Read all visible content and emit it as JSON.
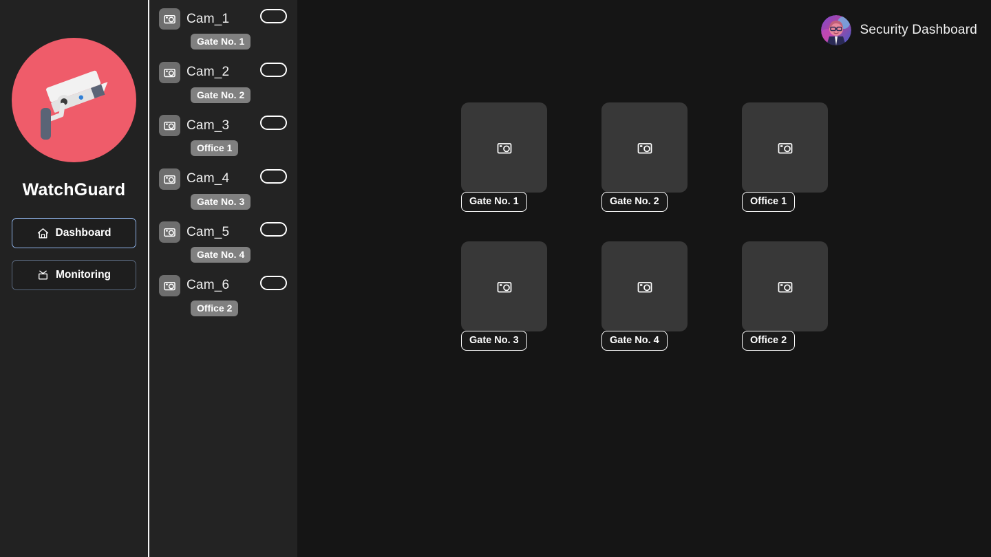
{
  "sidebar": {
    "logo_icon": "cctv-camera-icon",
    "logo_bg_color": "#ef5c6a",
    "brand_name": "WatchGuard",
    "nav_items": [
      {
        "label": "Dashboard",
        "icon": "home-icon",
        "active": true
      },
      {
        "label": "Monitoring",
        "icon": "tv-icon",
        "active": false
      }
    ]
  },
  "camera_list": {
    "items": [
      {
        "name": "Cam_1",
        "badge": "Gate No. 1",
        "icon": "camera-icon",
        "toggle_on": false
      },
      {
        "name": "Cam_2",
        "badge": "Gate No. 2",
        "icon": "camera-icon",
        "toggle_on": false
      },
      {
        "name": "Cam_3",
        "badge": "Office 1",
        "icon": "camera-icon",
        "toggle_on": false
      },
      {
        "name": "Cam_4",
        "badge": "Gate No. 3",
        "icon": "camera-icon",
        "toggle_on": false
      },
      {
        "name": "Cam_5",
        "badge": "Gate No. 4",
        "icon": "camera-icon",
        "toggle_on": false
      },
      {
        "name": "Cam_6",
        "badge": "Office 2",
        "icon": "camera-icon",
        "toggle_on": false
      }
    ]
  },
  "header": {
    "title": "Security Dashboard",
    "avatar_icon": "user-avatar-icon"
  },
  "main": {
    "tiles": [
      {
        "label": "Gate No. 1",
        "icon": "camera-icon"
      },
      {
        "label": "Gate No. 2",
        "icon": "camera-icon"
      },
      {
        "label": "Office 1",
        "icon": "camera-icon"
      },
      {
        "label": "Gate No. 3",
        "icon": "camera-icon"
      },
      {
        "label": "Gate No. 4",
        "icon": "camera-icon"
      },
      {
        "label": "Office 2",
        "icon": "camera-icon"
      }
    ]
  },
  "colors": {
    "accent": "#ef5c6a",
    "panel_bg": "#232323",
    "main_bg": "#151515",
    "tile_bg": "#383838",
    "badge_bg": "#808080",
    "active_border": "#8fb3e8"
  }
}
